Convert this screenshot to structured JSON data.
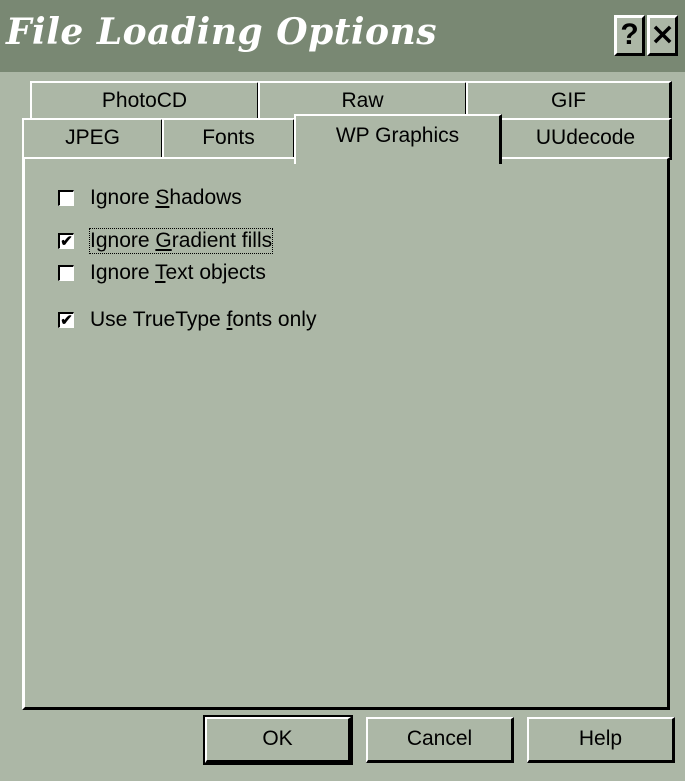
{
  "window": {
    "title": "File Loading Options",
    "help_glyph": "?",
    "close_glyph": "×"
  },
  "tabs": {
    "row1": [
      "PhotoCD",
      "Raw",
      "GIF"
    ],
    "row2": [
      "JPEG",
      "Fonts",
      "WP Graphics",
      "UUdecode"
    ],
    "active": "WP Graphics"
  },
  "options": [
    {
      "pre": "Ignore ",
      "key": "S",
      "post": "hadows",
      "checked": false,
      "mark": ""
    },
    {
      "pre": "Ignore ",
      "key": "G",
      "post": "radient fills",
      "checked": true,
      "mark": "✔"
    },
    {
      "pre": "Ignore ",
      "key": "T",
      "post": "ext objects",
      "checked": false,
      "mark": ""
    },
    {
      "pre": "Use TrueType ",
      "key": "f",
      "post": "onts only",
      "checked": true,
      "mark": "✔"
    }
  ],
  "buttons": {
    "ok": "OK",
    "cancel": "Cancel",
    "help": "Help"
  },
  "colors": {
    "face": "#acb7a6",
    "titlebar": "#798873"
  }
}
